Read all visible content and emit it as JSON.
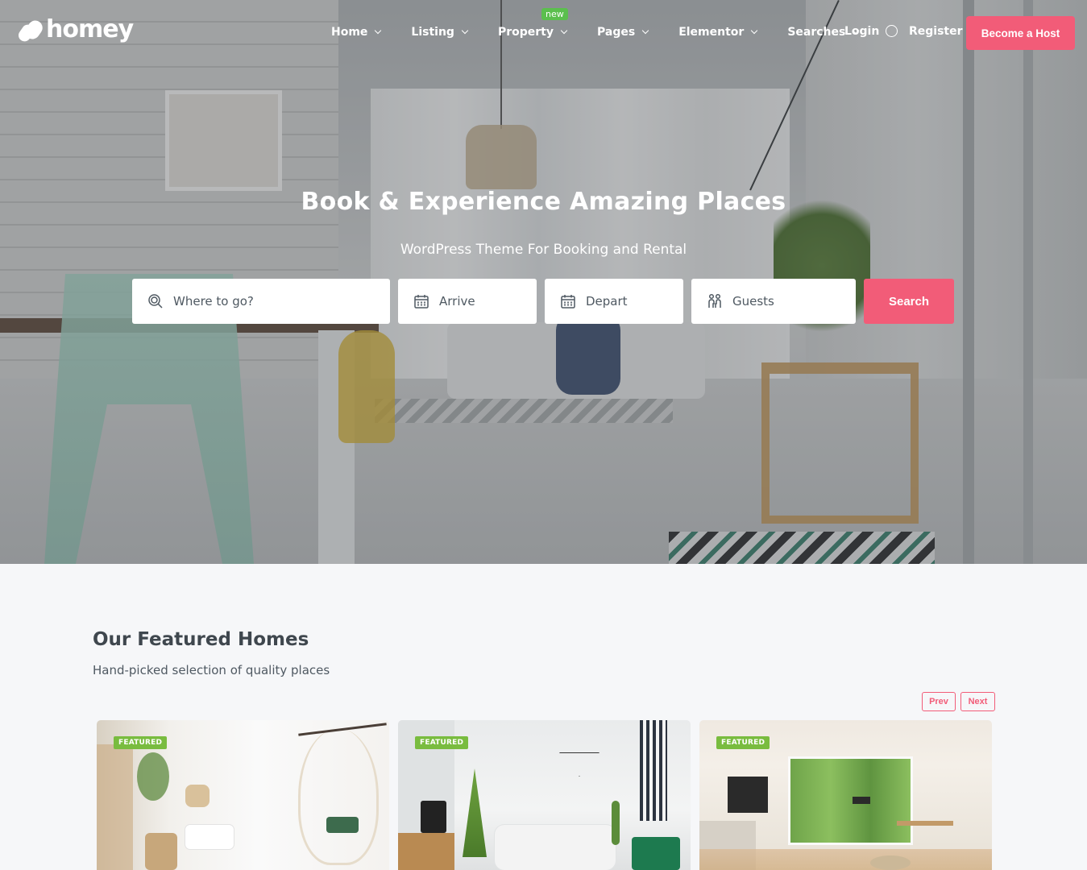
{
  "brand": {
    "name": "homey",
    "accent": "#f25c78",
    "badge_green": "#5bbf4e",
    "featured_green": "#79bc3f"
  },
  "nav": {
    "items": [
      {
        "label": "Home",
        "has_dropdown": true
      },
      {
        "label": "Listing",
        "has_dropdown": true
      },
      {
        "label": "Property",
        "has_dropdown": true,
        "badge": "new"
      },
      {
        "label": "Pages",
        "has_dropdown": true
      },
      {
        "label": "Elementor",
        "has_dropdown": true
      },
      {
        "label": "Searches",
        "has_dropdown": true
      }
    ],
    "login": "Login",
    "register": "Register",
    "cta": "Become a Host"
  },
  "hero": {
    "title": "Book & Experience Amazing Places",
    "subtitle": "WordPress Theme For Booking and Rental"
  },
  "search": {
    "where_placeholder": "Where to go?",
    "arrive_placeholder": "Arrive",
    "depart_placeholder": "Depart",
    "guests_placeholder": "Guests",
    "button": "Search"
  },
  "featured": {
    "title": "Our Featured Homes",
    "subtitle": "Hand-picked selection of quality places",
    "prev": "Prev",
    "next": "Next",
    "cards": [
      {
        "badge": "FEATURED"
      },
      {
        "badge": "FEATURED"
      },
      {
        "badge": "FEATURED"
      }
    ]
  }
}
